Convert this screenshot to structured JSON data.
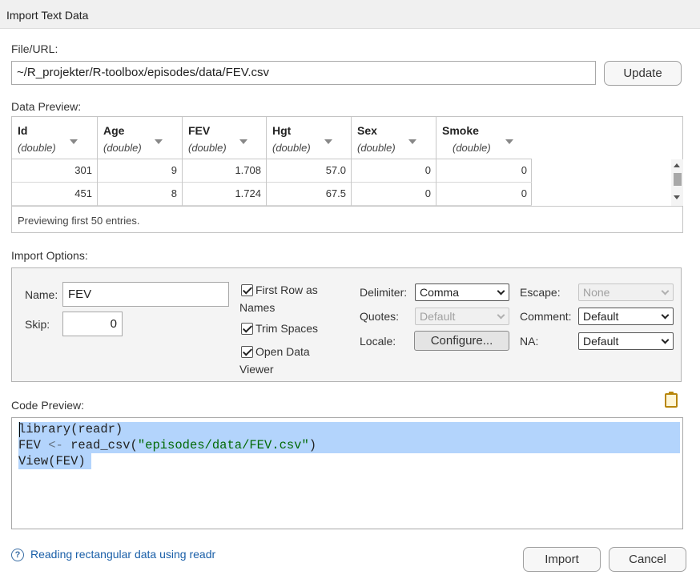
{
  "window": {
    "title": "Import Text Data"
  },
  "file": {
    "label": "File/URL:",
    "value": "~/R_projekter/R-toolbox/episodes/data/FEV.csv",
    "update_label": "Update"
  },
  "data_preview": {
    "label": "Data Preview:",
    "columns": [
      {
        "name": "Id",
        "type": "(double)"
      },
      {
        "name": "Age",
        "type": "(double)"
      },
      {
        "name": "FEV",
        "type": "(double)"
      },
      {
        "name": "Hgt",
        "type": "(double)"
      },
      {
        "name": "Sex",
        "type": "(double)"
      },
      {
        "name": "Smoke",
        "type": "(double)"
      }
    ],
    "rows": [
      [
        "301",
        "9",
        "1.708",
        "57.0",
        "0",
        "0"
      ],
      [
        "451",
        "8",
        "1.724",
        "67.5",
        "0",
        "0"
      ]
    ],
    "footer": "Previewing first 50 entries."
  },
  "import_options": {
    "label": "Import Options:",
    "name_label": "Name:",
    "name_value": "FEV",
    "skip_label": "Skip:",
    "skip_value": "0",
    "first_row_names_1": "First Row as",
    "first_row_names_2": "Names",
    "trim_spaces": "Trim Spaces",
    "open_viewer_1": "Open Data",
    "open_viewer_2": "Viewer",
    "delimiter_label": "Delimiter:",
    "delimiter_value": "Comma",
    "quotes_label": "Quotes:",
    "quotes_value": "Default",
    "locale_label": "Locale:",
    "configure_label": "Configure...",
    "escape_label": "Escape:",
    "escape_value": "None",
    "comment_label": "Comment:",
    "comment_value": "Default",
    "na_label": "NA:",
    "na_value": "Default"
  },
  "code_preview": {
    "label": "Code Preview:",
    "line1": "library(readr)",
    "line2_var": "FEV ",
    "line2_op": "<-",
    "line2_fn": " read_csv(",
    "line2_str": "\"episodes/data/FEV.csv\"",
    "line2_end": ")",
    "line3": "View(FEV)"
  },
  "footer": {
    "help_icon": "?",
    "help_link": "Reading rectangular data using readr",
    "import_label": "Import",
    "cancel_label": "Cancel"
  },
  "colors": {
    "selection": "#b3d4fc",
    "string": "#036a07",
    "link": "#1a5fa8"
  }
}
